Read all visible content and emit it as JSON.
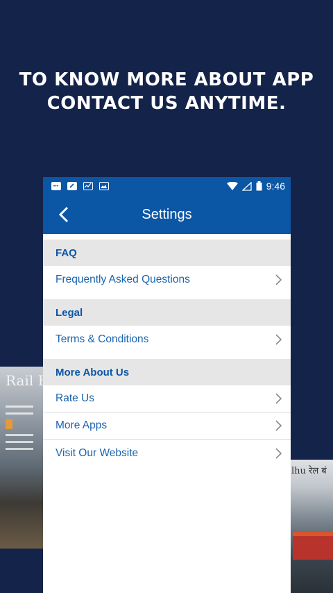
{
  "headline": {
    "line1": "TO KNOW MORE ABOUT APP",
    "line2": "CONTACT US ANYTIME."
  },
  "status_bar": {
    "time": "9:46",
    "left_icons": [
      "chat-icon",
      "edit-icon",
      "chart-icon",
      "image-icon"
    ],
    "right_icons": [
      "wifi-icon",
      "signal-icon",
      "battery-icon"
    ]
  },
  "app_bar": {
    "title": "Settings",
    "back_icon": "chevron-left-icon"
  },
  "sections": [
    {
      "header": "FAQ",
      "items": [
        "Frequently Asked Questions"
      ]
    },
    {
      "header": "Legal",
      "items": [
        "Terms & Conditions"
      ]
    },
    {
      "header": "More About Us",
      "items": [
        "Rate Us",
        "More Apps",
        "Visit Our Website"
      ]
    }
  ],
  "background": {
    "magazine_left_masthead": "Rail Ba",
    "magazine_right_masthead": "lhu रेल बं"
  },
  "colors": {
    "background": "#14234a",
    "primary": "#0c56a6",
    "section_bg": "#e6e6e6",
    "link_text": "#1a63ad"
  }
}
